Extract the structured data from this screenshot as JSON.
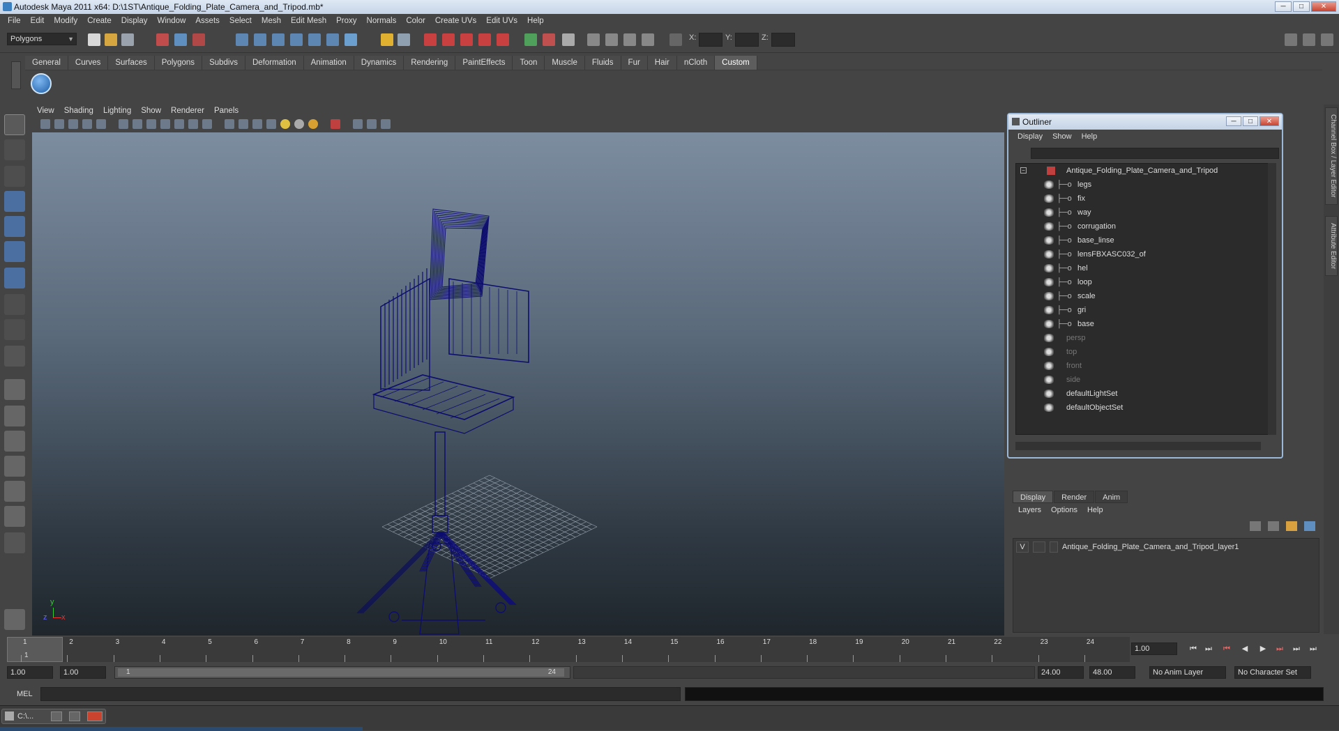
{
  "window": {
    "title": "Autodesk Maya 2011 x64: D:\\1ST\\Antique_Folding_Plate_Camera_and_Tripod.mb*",
    "buttons": [
      "─",
      "□",
      "✕"
    ]
  },
  "menubar": [
    "File",
    "Edit",
    "Modify",
    "Create",
    "Display",
    "Window",
    "Assets",
    "Select",
    "Mesh",
    "Edit Mesh",
    "Proxy",
    "Normals",
    "Color",
    "Create UVs",
    "Edit UVs",
    "Help"
  ],
  "status": {
    "mode": "Polygons",
    "x_label": "X:",
    "y_label": "Y:",
    "z_label": "Z:"
  },
  "shelf": {
    "tabs": [
      "General",
      "Curves",
      "Surfaces",
      "Polygons",
      "Subdivs",
      "Deformation",
      "Animation",
      "Dynamics",
      "Rendering",
      "PaintEffects",
      "Toon",
      "Muscle",
      "Fluids",
      "Fur",
      "Hair",
      "nCloth",
      "Custom"
    ],
    "active_tab": "Custom"
  },
  "viewport": {
    "menu": [
      "View",
      "Shading",
      "Lighting",
      "Show",
      "Renderer",
      "Panels"
    ],
    "axis_y": "y",
    "axis_z": "z",
    "axis_x": "x",
    "wire_color": "#0d0d6e"
  },
  "outliner": {
    "title": "Outliner",
    "menu": [
      "Display",
      "Show",
      "Help"
    ],
    "root": "Antique_Folding_Plate_Camera_and_Tripod",
    "children": [
      "legs",
      "fix",
      "way",
      "corrugation",
      "base_linse",
      "lensFBXASC032_of",
      "hel",
      "loop",
      "scale",
      "gri",
      "base"
    ],
    "cameras": [
      "persp",
      "top",
      "front",
      "side"
    ],
    "sets": [
      "defaultLightSet",
      "defaultObjectSet"
    ]
  },
  "layers": {
    "tabs": [
      "Display",
      "Render",
      "Anim"
    ],
    "active_tab": "Display",
    "menu": [
      "Layers",
      "Options",
      "Help"
    ],
    "layer_visible": "V",
    "layer_name": "Antique_Folding_Plate_Camera_and_Tripod_layer1"
  },
  "side_tabs": [
    "Channel Box / Layer Editor",
    "Attribute Editor"
  ],
  "timeline": {
    "ticks": [
      "1",
      "2",
      "3",
      "4",
      "5",
      "6",
      "7",
      "8",
      "9",
      "10",
      "11",
      "12",
      "13",
      "14",
      "15",
      "16",
      "17",
      "18",
      "19",
      "20",
      "21",
      "22",
      "23",
      "24"
    ],
    "current_frame": "1",
    "current_time": "1.00"
  },
  "range": {
    "start": "1.00",
    "playback_start": "1.00",
    "range_start": "1",
    "range_end": "24",
    "playback_end": "24.00",
    "end": "48.00",
    "anim_layer": "No Anim Layer",
    "character_set": "No Character Set"
  },
  "command": {
    "label": "MEL"
  },
  "taskbar": {
    "item": "C:\\..."
  }
}
